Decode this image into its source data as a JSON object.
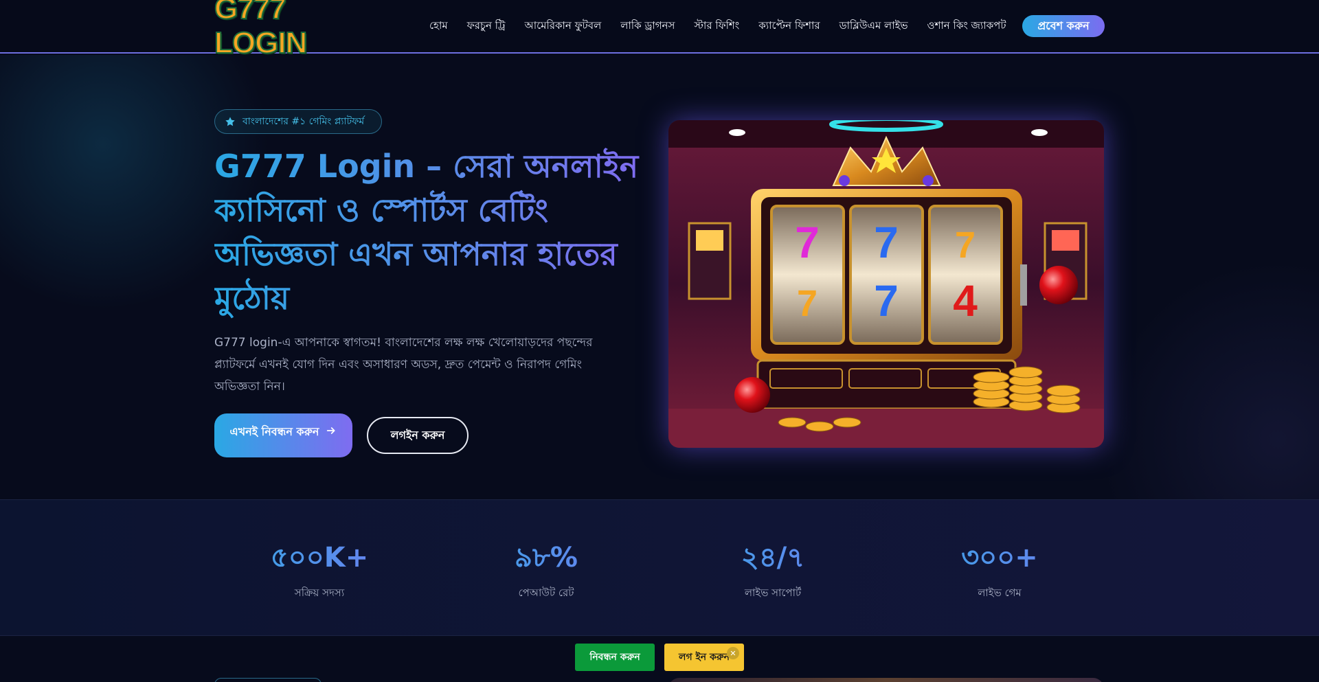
{
  "header": {
    "logo_text": "G777 LOGIN",
    "nav": [
      {
        "label": "হোম"
      },
      {
        "label": "ফরচুন ট্রি"
      },
      {
        "label": "আমেরিকান ফুটবল"
      },
      {
        "label": "লাকি ড্রাগনস"
      },
      {
        "label": "স্টার ফিশিং"
      },
      {
        "label": "ক্যাপ্টেন ফিশার"
      },
      {
        "label": "ডাব্লিউএম লাইভ"
      },
      {
        "label": "ওশান কিং জ্যাকপট"
      }
    ],
    "cta_label": "প্রবেশ করুন"
  },
  "hero": {
    "badge_icon": "star-icon",
    "badge_text": "বাংলাদেশের #১ গেমিং প্ল্যাটফর্ম",
    "title": "G777 Login – সেরা অনলাইন ক্যাসিনো ও স্পোর্টস বেটিং অভিজ্ঞতা এখন আপনার হাতের মুঠোয়",
    "description": "G777 login-এ আপনাকে স্বাগতম! বাংলাদেশের লক্ষ লক্ষ খেলোয়াড়দের পছন্দের প্ল্যাটফর্মে এখনই যোগ দিন এবং অসাধারণ অডস, দ্রুত পেমেন্ট ও নিরাপদ গেমিং অভিজ্ঞতা নিন।",
    "register_label": "এখনই নিবন্ধন করুন",
    "register_icon": "arrow-right-icon",
    "login_label": "লগইন করুন",
    "image_icon": "slot-machine-image"
  },
  "stats": [
    {
      "value": "৫০০K+",
      "label": "সক্রিয় সদস্য"
    },
    {
      "value": "৯৮%",
      "label": "পেআউট রেট"
    },
    {
      "value": "২৪/৭",
      "label": "লাইভ সাপোর্ট"
    },
    {
      "value": "৩০০+",
      "label": "লাইভ গেম"
    }
  ],
  "floating": {
    "register_label": "নিবন্ধন করুন",
    "login_label": "লগ ইন করুন",
    "close_icon": "close-icon"
  },
  "colors": {
    "accent_start": "#2aa8e4",
    "accent_end": "#7f6cf0",
    "background": "#070b1c",
    "register_green": "#0b9a3a",
    "login_yellow": "#f5c531"
  }
}
